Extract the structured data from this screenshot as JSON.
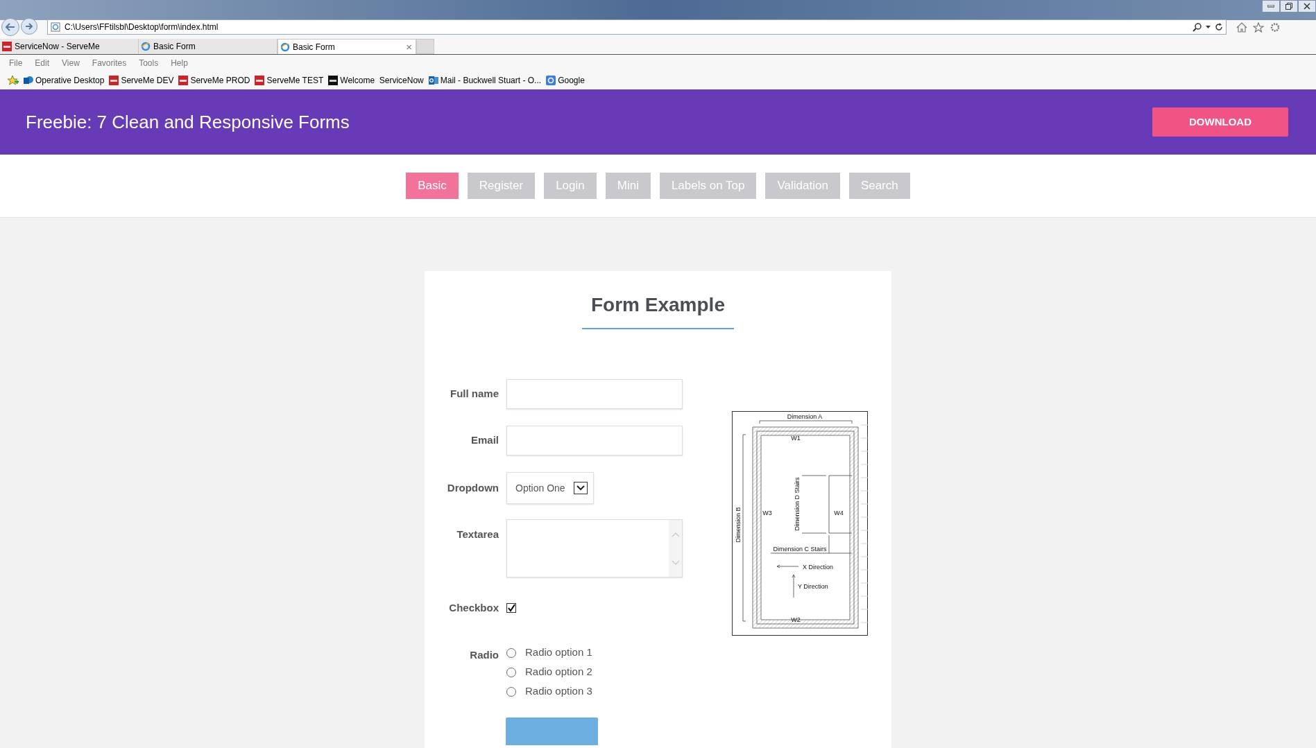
{
  "browser": {
    "address": "C:\\Users\\FFtilsbl\\Desktop\\form\\index.html",
    "tabs": [
      {
        "label": "ServiceNow - ServeMe",
        "kind": "now",
        "selected": false
      },
      {
        "label": "Basic Form",
        "kind": "ie",
        "selected": false
      },
      {
        "label": "Basic Form",
        "kind": "ie",
        "selected": true
      }
    ],
    "close_tab": "×",
    "menu": [
      "File",
      "Edit",
      "View",
      "Favorites",
      "Tools",
      "Help"
    ],
    "favorites": [
      {
        "label": "Operative Desktop",
        "kind": "sharepoint"
      },
      {
        "label": "ServeMe DEV",
        "kind": "now"
      },
      {
        "label": "ServeMe PROD",
        "kind": "now"
      },
      {
        "label": "ServeMe TEST",
        "kind": "now"
      },
      {
        "label": "Welcome  ServiceNow",
        "kind": "now_dark"
      },
      {
        "label": "Mail - Buckwell Stuart - O...",
        "kind": "outlook"
      },
      {
        "label": "Google",
        "kind": "google"
      }
    ]
  },
  "header": {
    "title": "Freebie: 7 Clean and Responsive Forms",
    "button": "DOWNLOAD"
  },
  "nav": [
    {
      "label": "Basic",
      "selected": true
    },
    {
      "label": "Register",
      "selected": false
    },
    {
      "label": "Login",
      "selected": false
    },
    {
      "label": "Mini",
      "selected": false
    },
    {
      "label": "Labels on Top",
      "selected": false
    },
    {
      "label": "Validation",
      "selected": false
    },
    {
      "label": "Search",
      "selected": false
    }
  ],
  "form": {
    "title": "Form Example",
    "fields": [
      {
        "kind": "text",
        "label": "Full name"
      },
      {
        "kind": "text",
        "label": "Email"
      },
      {
        "kind": "select",
        "label": "Dropdown",
        "value": "Option One"
      },
      {
        "kind": "textarea",
        "label": "Textarea"
      },
      {
        "kind": "checkbox",
        "label": "Checkbox",
        "checked": true
      },
      {
        "kind": "radio",
        "label": "Radio",
        "options": [
          {
            "label": "Radio option 1",
            "selected": false
          },
          {
            "label": "Radio option 2",
            "selected": false
          },
          {
            "label": "Radio option 3",
            "selected": false
          }
        ]
      }
    ],
    "floor_plan": {
      "dimension_a": "Dimension A",
      "dimension_b": "Dimension B",
      "w1": "W1",
      "w2": "W2",
      "w3": "W3",
      "w4": "W4",
      "dimension_d": "Dimension D Stairs",
      "dimension_c": "Dimension C Stairs",
      "x_direction": "X Direction",
      "y_direction": "Y Direction"
    }
  }
}
